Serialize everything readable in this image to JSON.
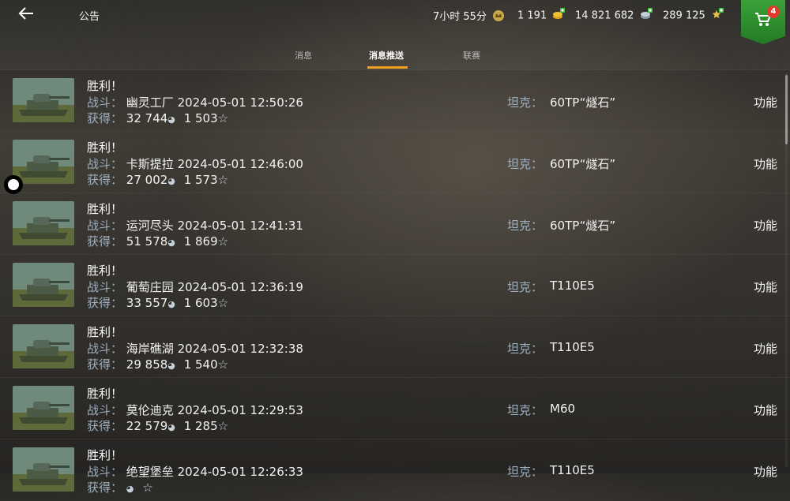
{
  "header": {
    "title": "公告",
    "back_icon": "back-arrow-icon",
    "timer": "7小时 55分",
    "gold": "1 191",
    "silver": "14 821 682",
    "free_xp": "289 125",
    "cart_badge": "4"
  },
  "tabs": [
    {
      "label": "消息"
    },
    {
      "label": "消息推送",
      "active": true
    },
    {
      "label": "联赛"
    }
  ],
  "labels": {
    "battle": "战斗：",
    "earned": "获得：",
    "tank": "坦克：",
    "function": "功能"
  },
  "rows": [
    {
      "title": "胜利！",
      "map": "幽灵工厂",
      "datetime": "2024-05-01 12:50:26",
      "credits": "32 744",
      "xp": "1 503",
      "tank": "60TP“燧石”"
    },
    {
      "title": "胜利！",
      "map": "卡斯提拉",
      "datetime": "2024-05-01 12:46:00",
      "credits": "27 002",
      "xp": "1 573",
      "tank": "60TP“燧石”"
    },
    {
      "title": "胜利！",
      "map": "运河尽头",
      "datetime": "2024-05-01 12:41:31",
      "credits": "51 578",
      "xp": "1 869",
      "tank": "60TP“燧石”"
    },
    {
      "title": "胜利！",
      "map": "葡萄庄园",
      "datetime": "2024-05-01 12:36:19",
      "credits": "33 557",
      "xp": "1 603",
      "tank": "T110E5"
    },
    {
      "title": "胜利！",
      "map": "海岸礁湖",
      "datetime": "2024-05-01 12:32:38",
      "credits": "29 858",
      "xp": "1 540",
      "tank": "T110E5"
    },
    {
      "title": "胜利！",
      "map": "莫伦迪克",
      "datetime": "2024-05-01 12:29:53",
      "credits": "22 579",
      "xp": "1 285",
      "tank": "M60"
    },
    {
      "title": "胜利！",
      "map": "绝望堡垒",
      "datetime": "2024-05-01 12:26:33",
      "credits": "",
      "xp": "",
      "tank": "T110E5"
    }
  ]
}
